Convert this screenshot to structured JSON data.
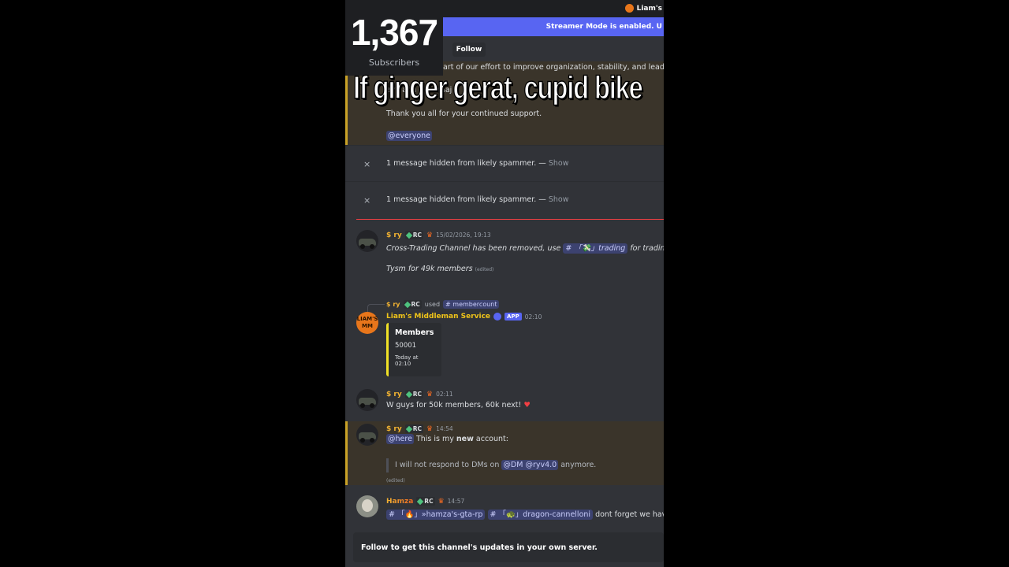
{
  "subscriber_counter": {
    "count": "1,367",
    "label": "Subscribers"
  },
  "overlay_caption": "If ginger gerat, cupid bike",
  "topbar": {
    "server_name": "Liam's"
  },
  "banner": {
    "text": "Streamer Mode is enabled. U"
  },
  "follow_button": "Follow",
  "announcement": {
    "line1": "art of our effort to improve organization, stability, and leadersh",
    "line2": "ave                       and                     o t                    o maj",
    "line3": "Thank you all for your continued support.",
    "mention": "@everyone"
  },
  "hidden_messages": [
    {
      "text": "1 message hidden from likely spammer. — ",
      "action": "Show",
      "close": "×"
    },
    {
      "text": "1 message hidden from likely spammer. — ",
      "action": "Show",
      "close": "×"
    }
  ],
  "messages": [
    {
      "author": "$ ry",
      "tag": "RC",
      "time": "15/02/2026, 19:13",
      "line1_pre": "Cross-Trading Channel has been removed, use ",
      "channel": "# 「💸」trading",
      "line1_post": " for trading p",
      "line2": "Tysm for 49k members",
      "edited": "(edited)"
    },
    {
      "reply_author": "$ ry",
      "reply_tag": "RC",
      "reply_used": "used",
      "reply_command": "# membercount",
      "author": "Liam's Middleman Service",
      "app_badge": "APP",
      "time": "02:10",
      "avatar_text": "LIAM'S MM",
      "embed": {
        "title": "Members",
        "value": "50001",
        "footer": "Today at 02:10"
      }
    },
    {
      "author": "$ ry",
      "tag": "RC",
      "time": "02:11",
      "text": "W guys for 50k members, 60k next! ",
      "emoji": "♥"
    },
    {
      "author": "$ ry",
      "tag": "RC",
      "time": "14:54",
      "mention": "@here",
      "pre": " This is my ",
      "bold": "new",
      "post": " account:",
      "quote_pre": "I will not respond to DMs on ",
      "quote_mention": "@DM @ryv4.0",
      "quote_post": " anymore.",
      "edited": "(edited)"
    },
    {
      "author": "Hamza",
      "tag": "RC",
      "time": "14:57",
      "channel1": "# 「🔥」»hamza's-gta-rp",
      "channel2": "# 「🐢」dragon-cannelloni",
      "text": " dont forget we have"
    }
  ],
  "footer": "Follow to get this channel's updates in your own server.",
  "colors": {
    "accent": "#5865f2",
    "highlight_border": "#c9a227",
    "new_divider": "#f23f43",
    "author": "#f0b232"
  }
}
